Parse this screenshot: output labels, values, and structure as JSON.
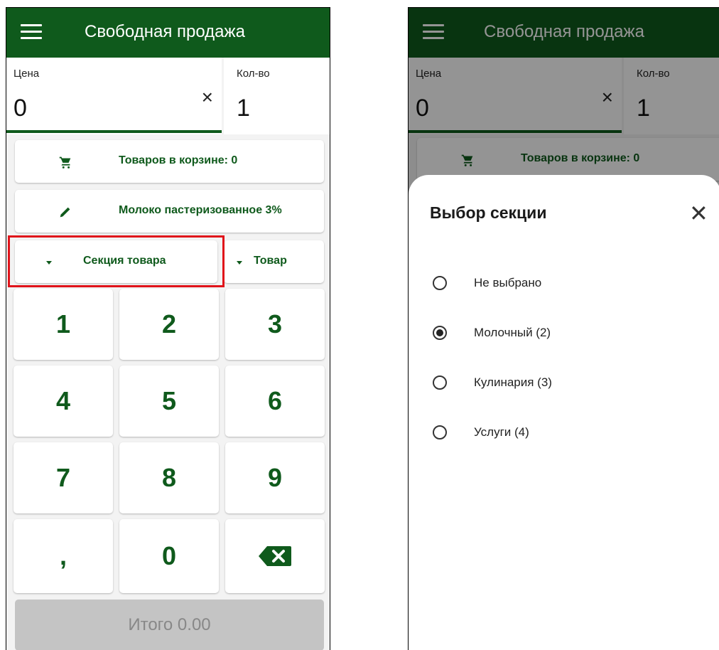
{
  "app": {
    "title": "Свободная продажа",
    "menu_icon": "hamburger-menu-icon",
    "accent_color": "#0f5a1c"
  },
  "price": {
    "label": "Цена",
    "value": "0",
    "clear_glyph": "×"
  },
  "quantity": {
    "label": "Кол-во",
    "value": "1"
  },
  "cart": {
    "label": "Товаров в корзине: 0",
    "icon": "cart-icon"
  },
  "product_name": {
    "label": "Молоко пастеризованное 3%",
    "icon": "pencil-icon"
  },
  "section_dropdown": {
    "label": "Секция товара",
    "icon": "dropdown-arrow-icon"
  },
  "product_dropdown": {
    "label": "Товар",
    "icon": "dropdown-arrow-icon"
  },
  "keypad": [
    "1",
    "2",
    "3",
    "4",
    "5",
    "6",
    "7",
    "8",
    "9",
    ",",
    "0"
  ],
  "keypad_backspace_icon": "backspace-icon",
  "total": {
    "label": "Итого 0.00"
  },
  "section_sheet": {
    "title": "Выбор секции",
    "close_glyph": "✕",
    "options": [
      {
        "label": "Не выбрано",
        "selected": false
      },
      {
        "label": "Молочный (2)",
        "selected": true
      },
      {
        "label": "Кулинария (3)",
        "selected": false
      },
      {
        "label": "Услуги (4)",
        "selected": false
      }
    ]
  },
  "highlight_color": "#e0131a"
}
